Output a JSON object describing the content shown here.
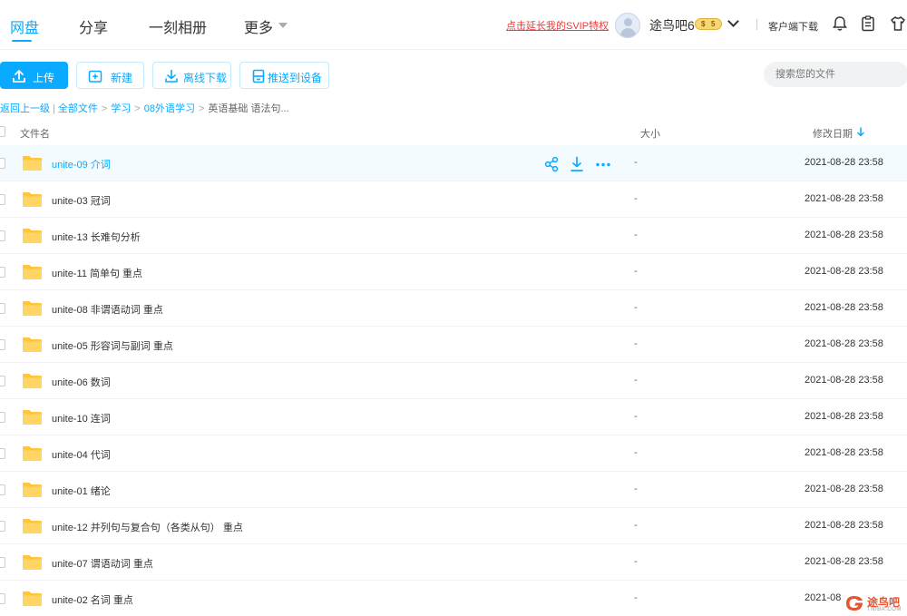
{
  "nav": {
    "tabs": [
      {
        "label": "网盘",
        "active": true
      },
      {
        "label": "分享",
        "active": false
      },
      {
        "label": "一刻相册",
        "active": false
      },
      {
        "label": "更多",
        "active": false
      }
    ],
    "promo_link": "点击延长我的SVIP特权",
    "username": "途鸟吧6",
    "vip_badge_left": "$",
    "vip_badge_right": "5",
    "client_download": "客户端下载",
    "icons": [
      "bell-icon",
      "clipboard-icon",
      "shirt-icon"
    ]
  },
  "toolbar": {
    "upload": "上传",
    "new_folder": "新建",
    "offline_download": "离线下载",
    "push_to_device": "推送到设备",
    "search_placeholder": "搜索您的文件"
  },
  "breadcrumb": {
    "back": "返回上一级",
    "items": [
      "全部文件",
      "学习",
      "08外语学习"
    ],
    "current": "英语基础 语法句..."
  },
  "table": {
    "headers": {
      "name": "文件名",
      "size": "大小",
      "modified": "修改日期"
    },
    "sort": "modified-desc",
    "rows": [
      {
        "name": "unite-09 介词",
        "size": "-",
        "modified": "2021-08-28 23:58",
        "hover": true
      },
      {
        "name": "unite-03 冠词",
        "size": "-",
        "modified": "2021-08-28 23:58"
      },
      {
        "name": "unite-13 长难句分析",
        "size": "-",
        "modified": "2021-08-28 23:58"
      },
      {
        "name": "unite-11 简单句 重点",
        "size": "-",
        "modified": "2021-08-28 23:58"
      },
      {
        "name": "unite-08 非谓语动词 重点",
        "size": "-",
        "modified": "2021-08-28 23:58"
      },
      {
        "name": "unite-05 形容词与副词 重点",
        "size": "-",
        "modified": "2021-08-28 23:58"
      },
      {
        "name": "unite-06 数词",
        "size": "-",
        "modified": "2021-08-28 23:58"
      },
      {
        "name": "unite-10 连词",
        "size": "-",
        "modified": "2021-08-28 23:58"
      },
      {
        "name": "unite-04 代词",
        "size": "-",
        "modified": "2021-08-28 23:58"
      },
      {
        "name": "unite-01 绪论",
        "size": "-",
        "modified": "2021-08-28 23:58"
      },
      {
        "name": "unite-12 并列句与复合句（各类从句） 重点",
        "size": "-",
        "modified": "2021-08-28 23:58"
      },
      {
        "name": "unite-07 谓语动词 重点",
        "size": "-",
        "modified": "2021-08-28 23:58"
      },
      {
        "name": "unite-02 名词 重点",
        "size": "-",
        "modified": "2021-08"
      }
    ],
    "row_actions": [
      "share-icon",
      "download-icon",
      "more-icon"
    ]
  },
  "watermark": {
    "text": "途鸟吧",
    "sub": "TNIBA.COM"
  },
  "colors": {
    "accent": "#09aaff",
    "promo": "#f13a3a",
    "folder": "#ffc53d"
  }
}
